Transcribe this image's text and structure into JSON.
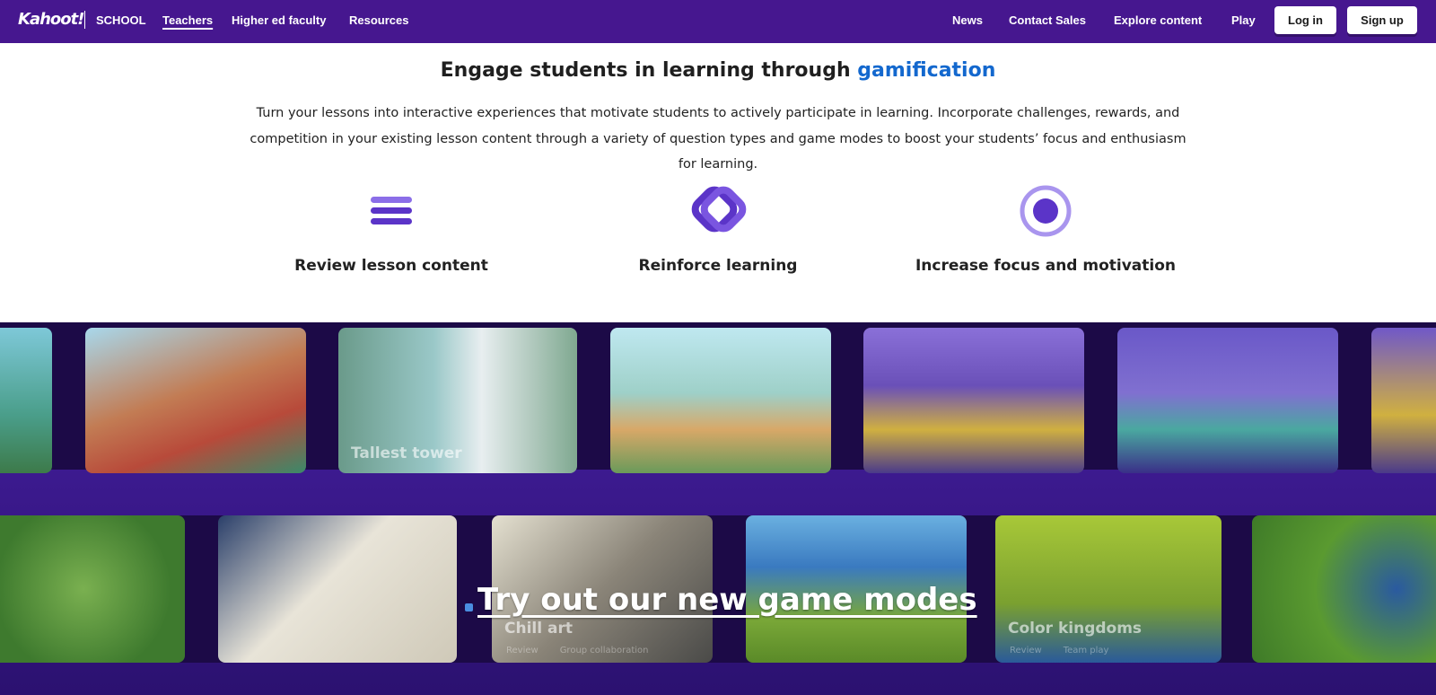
{
  "nav": {
    "logo": "Kahoot!",
    "section": "SCHOOL",
    "links": [
      "Teachers",
      "Higher ed faculty",
      "Resources"
    ],
    "right_links": [
      "News",
      "Contact Sales",
      "Explore content",
      "Play"
    ],
    "login": "Log in",
    "signup": "Sign up"
  },
  "hero": {
    "headline_prefix": "Engage students in learning through ",
    "headline_accent": "gamification",
    "lead": "Turn your lessons into interactive experiences that motivate students to actively participate in learning. Incorporate challenges, rewards, and competition in your existing lesson content through a variety of question types and game modes to boost your students’ focus and enthusiasm for learning."
  },
  "features": [
    {
      "label": "Review lesson content",
      "icon": "lines-icon"
    },
    {
      "label": "Reinforce learning",
      "icon": "linked-rings-icon"
    },
    {
      "label": "Increase focus and motivation",
      "icon": "target-icon"
    }
  ],
  "games_row1": {
    "cards": [
      {
        "title": ""
      },
      {
        "title": ""
      },
      {
        "title": "Tallest tower"
      },
      {
        "title": ""
      },
      {
        "title": ""
      },
      {
        "title": ""
      },
      {
        "title": ""
      }
    ]
  },
  "games_row2": {
    "cards": [
      {
        "title": ""
      },
      {
        "title": ""
      },
      {
        "title": "Chill art",
        "tags": [
          "Review",
          "Group collaboration"
        ]
      },
      {
        "title": ""
      },
      {
        "title": "Color kingdoms",
        "tags": [
          "Review",
          "Team play"
        ]
      },
      {
        "title": ""
      }
    ]
  },
  "cta": "Try out our new game modes",
  "colors": {
    "brand_purple": "#46178f",
    "accent_blue": "#1368ce",
    "icon_purple": "#6c3fd6"
  }
}
